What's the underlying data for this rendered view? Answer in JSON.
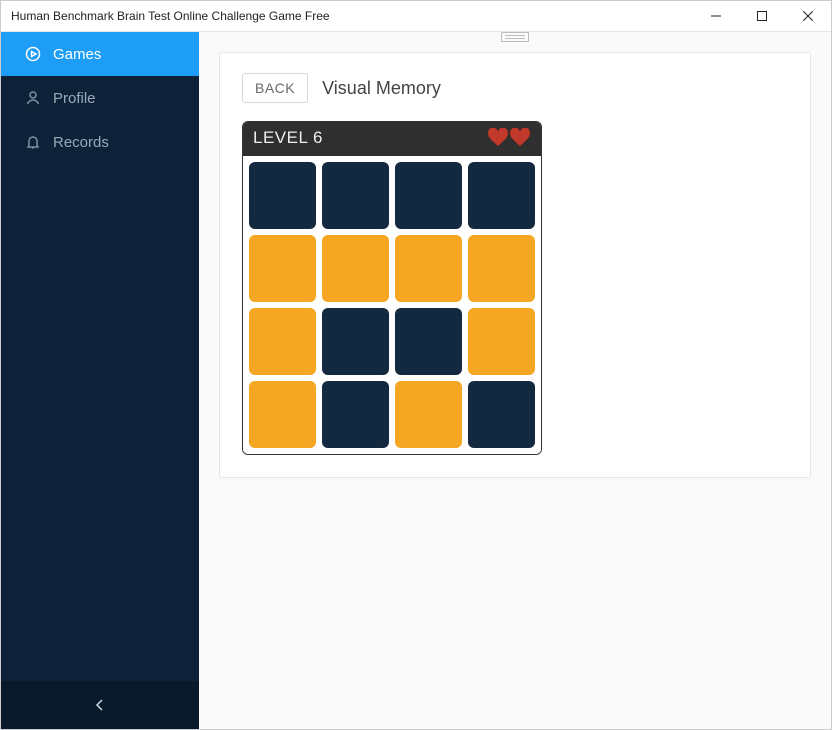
{
  "window": {
    "title": "Human Benchmark Brain Test Online Challenge Game Free"
  },
  "sidebar": {
    "items": [
      {
        "label": "Games",
        "icon": "play-circle-icon",
        "active": true
      },
      {
        "label": "Profile",
        "icon": "person-icon",
        "active": false
      },
      {
        "label": "Records",
        "icon": "bell-icon",
        "active": false
      }
    ]
  },
  "page": {
    "back_label": "BACK",
    "title": "Visual Memory"
  },
  "game": {
    "level_label": "LEVEL 6",
    "lives": 2,
    "grid_size": 4,
    "colors": {
      "tile_off": "#13293f",
      "tile_on": "#f5a623"
    },
    "grid": [
      [
        0,
        0,
        0,
        0
      ],
      [
        1,
        1,
        1,
        1
      ],
      [
        1,
        0,
        0,
        1
      ],
      [
        1,
        0,
        1,
        0
      ]
    ]
  }
}
